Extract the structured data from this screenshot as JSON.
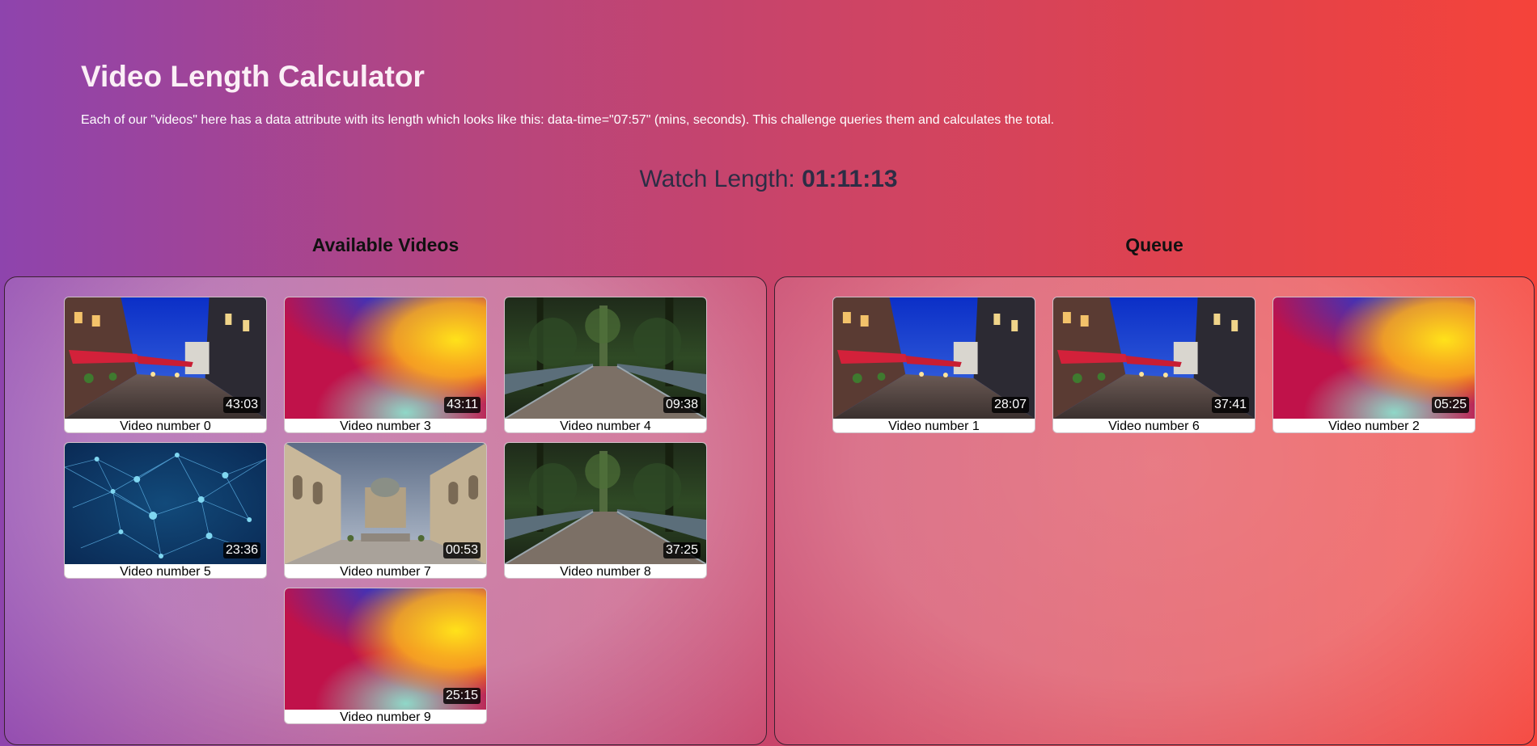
{
  "header": {
    "title": "Video Length Calculator",
    "description": "Each of our \"videos\" here has a data attribute with its length which looks like this: data-time=\"07:57\" (mins, seconds). This challenge queries them and calculates the total."
  },
  "watch": {
    "label": "Watch Length:",
    "value": "01:11:13"
  },
  "available": {
    "title": "Available Videos",
    "videos": [
      {
        "label": "Video number 0",
        "duration": "43:03",
        "thumbnail": "street-cafe-night"
      },
      {
        "label": "Video number 3",
        "duration": "43:11",
        "thumbnail": "abstract-gradient"
      },
      {
        "label": "Video number 4",
        "duration": "09:38",
        "thumbnail": "forest-bridge"
      },
      {
        "label": "Video number 5",
        "duration": "23:36",
        "thumbnail": "network-mesh"
      },
      {
        "label": "Video number 7",
        "duration": "00:53",
        "thumbnail": "memorial-courtyard"
      },
      {
        "label": "Video number 8",
        "duration": "37:25",
        "thumbnail": "forest-bridge"
      },
      {
        "label": "Video number 9",
        "duration": "25:15",
        "thumbnail": "abstract-gradient"
      }
    ]
  },
  "queue": {
    "title": "Queue",
    "videos": [
      {
        "label": "Video number 1",
        "duration": "28:07",
        "thumbnail": "street-cafe-night"
      },
      {
        "label": "Video number 6",
        "duration": "37:41",
        "thumbnail": "street-cafe-night"
      },
      {
        "label": "Video number 2",
        "duration": "05:25",
        "thumbnail": "abstract-gradient"
      }
    ]
  }
}
